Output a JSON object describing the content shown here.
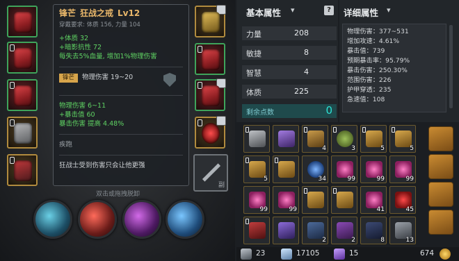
{
  "tooltip": {
    "name": "锋芒",
    "item": "狂战之戒",
    "level": "Lv12",
    "requirement": "穿戴要求: 体质 156, 力量 104",
    "bonus_lines": [
      "+体质 32",
      "+暗影抗性 72",
      "每失去5%血量, 增加1%物理伤害"
    ],
    "set_tag": "锋芒",
    "set_stat": "物理伤害 19~20",
    "stat_lines": [
      "物理伤害 6~11",
      "+暴击值 60",
      "暴击伤害 提高 4.48%"
    ],
    "skill_name": "疾跑",
    "flavor": "狂战士受到伤害只会让他更强"
  },
  "unequip_hint": "双击或拖拽脱卸",
  "weapon_slot_label": "副",
  "basic_attributes": {
    "title": "基本属性",
    "rows": [
      {
        "label": "力量",
        "value": "208"
      },
      {
        "label": "敏捷",
        "value": "8"
      },
      {
        "label": "智慧",
        "value": "4"
      },
      {
        "label": "体质",
        "value": "225"
      }
    ],
    "free_points_label": "剩余点数",
    "free_points": "0"
  },
  "detail_attributes": {
    "title": "详细属性",
    "lines": [
      "物理伤害：377~531",
      "增加攻速：4.61%",
      "暴击值：739",
      "预期暴击率：95.79%",
      "暴击伤害：250.30%",
      "范围伤害：226",
      "护甲穿透：235",
      "急速值：108"
    ]
  },
  "inventory_counts": [
    "",
    "",
    "4",
    "3",
    "5",
    "5",
    "5",
    "34",
    "99",
    "99",
    "99",
    "99",
    "99",
    "",
    "",
    "",
    "41",
    "45",
    "",
    "",
    "2",
    "2",
    "8",
    "13"
  ],
  "status": {
    "materials": "23",
    "gems": "17105",
    "crystals": "15",
    "gold": "674"
  },
  "colors": {
    "accent_gold": "#e9b76a",
    "stat_green": "#5fd263",
    "points_cyan": "#2de2d4"
  }
}
